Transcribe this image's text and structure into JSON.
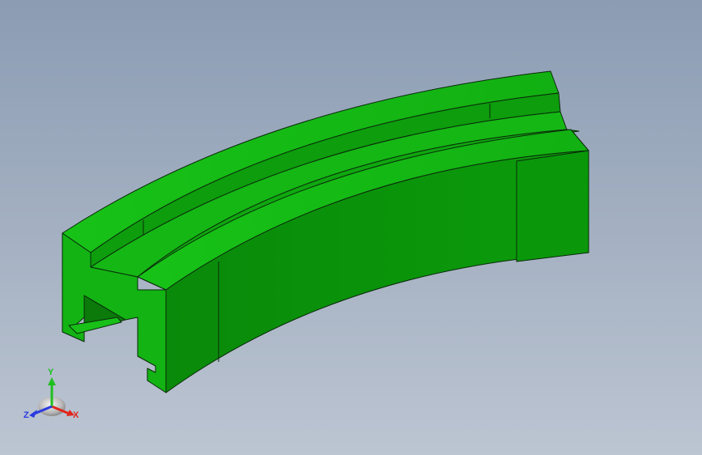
{
  "viewport": {
    "background_top": "#8b9cb3",
    "background_bottom": "#bcc5d2"
  },
  "model": {
    "color_top": "#10b510",
    "color_front": "#0a8f0a",
    "color_side": "#0c9f0c",
    "edge_color": "#0a2a0a"
  },
  "triad": {
    "x_label": "X",
    "y_label": "Y",
    "z_label": "Z",
    "x_color": "#e0261c",
    "y_color": "#1fbf1f",
    "z_color": "#2a3adf"
  }
}
